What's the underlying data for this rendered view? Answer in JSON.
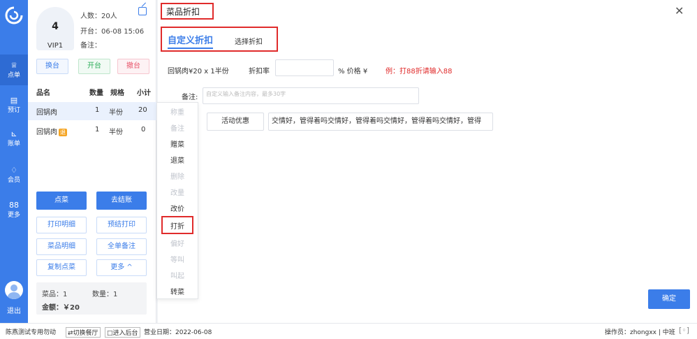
{
  "rail": {
    "items": [
      {
        "label": "点单",
        "icon": "bell-icon"
      },
      {
        "label": "预订",
        "icon": "calendar-icon"
      },
      {
        "label": "账单",
        "icon": "chart-icon"
      },
      {
        "label": "会员",
        "icon": "diamond-icon"
      },
      {
        "label": "更多",
        "icon": "grid-icon"
      }
    ],
    "logout": "退出"
  },
  "order": {
    "table_no": "4",
    "table_name": "VIP1",
    "guests": "人数：20人",
    "open_time": "开台：06-08 15:06",
    "remark": "备注：",
    "actions": [
      "换台",
      "开台",
      "撤台"
    ],
    "columns": [
      "品名",
      "数量",
      "规格",
      "小计"
    ],
    "items": [
      {
        "name": "回锅肉",
        "qty": "1",
        "spec": "半份",
        "subtotal": "20",
        "badge": ""
      },
      {
        "name": "回锅肉",
        "qty": "1",
        "spec": "半份",
        "subtotal": "0",
        "badge": "退"
      }
    ],
    "buttons": {
      "order": "点菜",
      "checkout": "去结账",
      "print_detail": "打印明细",
      "pre_print": "预结打印",
      "dish_detail": "菜品明细",
      "all_remark": "全单备注",
      "copy_order": "复制点菜",
      "more": "更多 ^"
    },
    "summary": {
      "dishes": "菜品：1",
      "quantity": "数量：1",
      "amount": "金额：￥20"
    }
  },
  "context_menu": {
    "items": [
      {
        "label": "称重",
        "enabled": false
      },
      {
        "label": "备注",
        "enabled": false
      },
      {
        "label": "赠菜",
        "enabled": true
      },
      {
        "label": "退菜",
        "enabled": true
      },
      {
        "label": "删除",
        "enabled": false
      },
      {
        "label": "改量",
        "enabled": false
      },
      {
        "label": "改价",
        "enabled": true
      },
      {
        "label": "打折",
        "enabled": true
      },
      {
        "label": "偏好",
        "enabled": false
      },
      {
        "label": "等叫",
        "enabled": false
      },
      {
        "label": "叫起",
        "enabled": false
      },
      {
        "label": "转菜",
        "enabled": true
      }
    ]
  },
  "modal": {
    "title": "菜品折扣",
    "tabs": [
      "自定义折扣",
      "选择折扣"
    ],
    "dish_line": "回锅肉¥20 x 1半份",
    "rate_label": "折扣率",
    "rate_value": "",
    "percent_price": "%  价格 ¥",
    "hint": "例：打88折请输入88",
    "remark_label": "备注:",
    "remark_placeholder": "自定义输入备注内容，最多30字",
    "promo_button": "活动优惠",
    "promo_text": "交情好，管得着吗交情好，管得着吗交情好，管得着吗交情好，管得",
    "confirm": "确定"
  },
  "status_bar": {
    "brand": "陈燕测试专用勿动",
    "switch": "⇄切换餐厅",
    "backend": "□进入后台",
    "business_date": "营业日期：2022-06-08",
    "operator": "操作员：zhongxx | 中班"
  },
  "colors": {
    "primary": "#3b7de9",
    "danger": "#e02b2b",
    "success": "#2fae5b",
    "warning": "#f5a524"
  }
}
